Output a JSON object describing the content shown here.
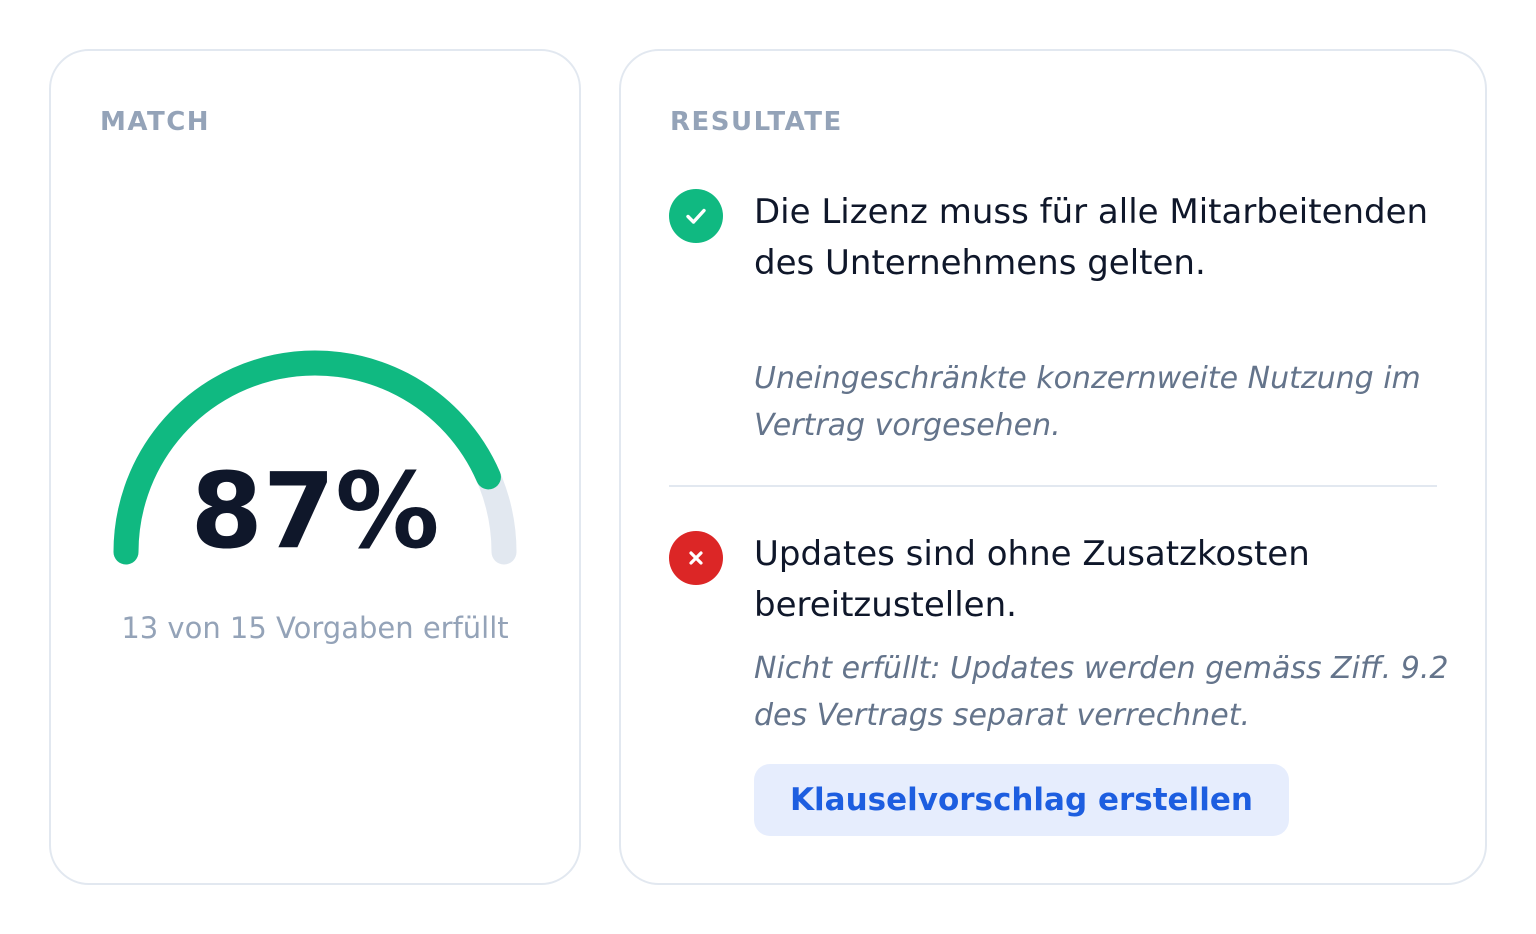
{
  "match": {
    "label": "MATCH",
    "value_text": "87%",
    "fraction": 0.87,
    "subtitle": "13 von 15 Vorgaben erfüllt",
    "colors": {
      "fill": "#10b981",
      "track": "#e2e8f0"
    }
  },
  "results": {
    "label": "RESULTATE",
    "items": [
      {
        "status": "fulfilled",
        "icon": "check-icon",
        "title": "Die Lizenz muss für alle Mitarbeitenden des Unternehmens gelten.",
        "note": "Uneingeschränkte konzernweite Nutzung im Vertrag vorgesehen."
      },
      {
        "status": "not-fulfilled",
        "icon": "close-icon",
        "title": "Updates sind ohne Zusatzkosten bereitzustellen.",
        "note": "Nicht erfüllt: Updates werden gemäss Ziff. 9.2 des Vertrags separat verrechnet."
      }
    ],
    "action_label": "Klauselvorschlag erstellen"
  },
  "colors": {
    "success": "#10b981",
    "error": "#dc2626",
    "accent": "#1d5ee0",
    "muted": "#94a3b8"
  }
}
